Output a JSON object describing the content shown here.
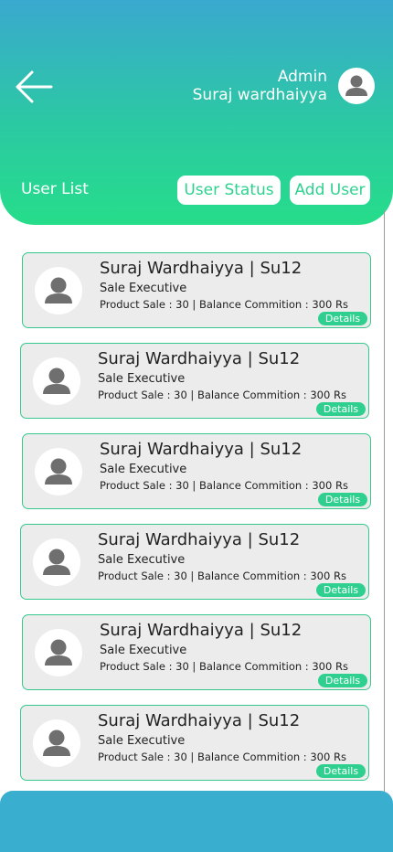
{
  "header": {
    "role": "Admin",
    "name": "Suraj wardhaiyya",
    "title": "User List",
    "buttons": {
      "status": "User Status",
      "add": "Add User"
    }
  },
  "colors": {
    "gradient_top": "#3aa9cf",
    "gradient_bottom": "#26dd8a",
    "accent": "#2fd08f",
    "card_bg": "#ececec",
    "footer": "#3aaecf"
  },
  "icons": {
    "back": "back-arrow-icon",
    "avatar": "user-avatar-icon"
  },
  "users": [
    {
      "name": "Suraj Wardhaiyya  |  Su12",
      "role": "Sale Executive",
      "stats": "Product Sale : 30 | Balance Commition : 300 Rs",
      "action": "Details"
    },
    {
      "name": "Suraj Wardhaiyya  |  Su12",
      "role": "Sale Executive",
      "stats": "Product Sale : 30 | Balance Commition : 300 Rs",
      "action": "Details"
    },
    {
      "name": "Suraj Wardhaiyya  |  Su12",
      "role": "Sale Executive",
      "stats": "Product Sale : 30 | Balance Commition : 300 Rs",
      "action": "Details"
    },
    {
      "name": "Suraj Wardhaiyya  |  Su12",
      "role": "Sale Executive",
      "stats": "Product Sale : 30 | Balance Commition : 300 Rs",
      "action": "Details"
    },
    {
      "name": "Suraj Wardhaiyya  |  Su12",
      "role": "Sale Executive",
      "stats": "Product Sale : 30 | Balance Commition : 300 Rs",
      "action": "Details"
    },
    {
      "name": "Suraj Wardhaiyya  |  Su12",
      "role": "Sale Executive",
      "stats": "Product Sale : 30 | Balance Commition : 300 Rs",
      "action": "Details"
    }
  ]
}
